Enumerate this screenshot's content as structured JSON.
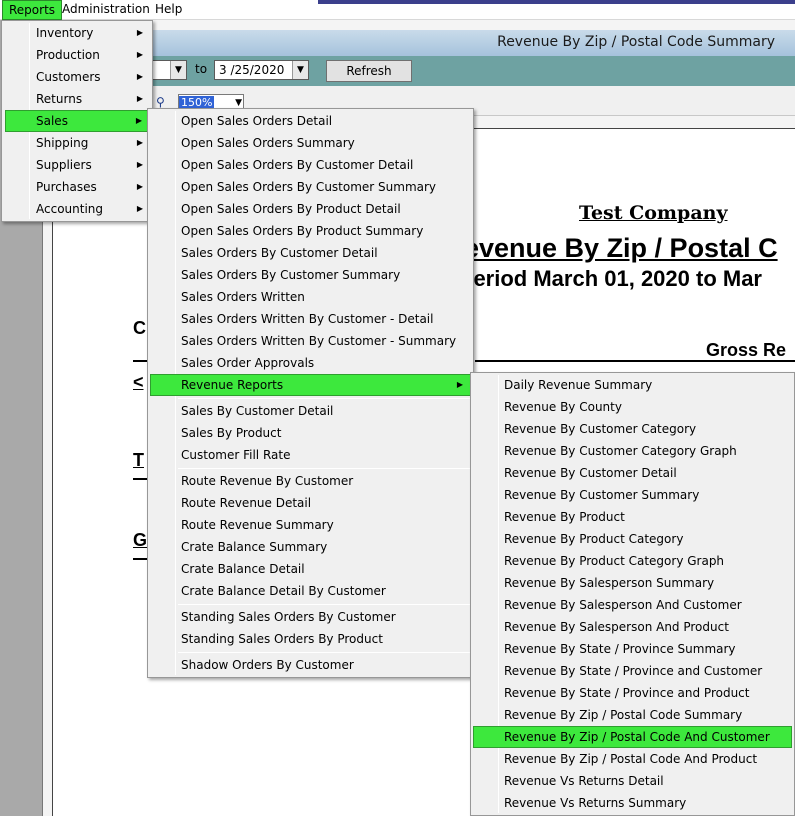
{
  "menubar": {
    "items": [
      "Reports",
      "Administration",
      "Help"
    ]
  },
  "window": {
    "title": "Revenue By Zip / Postal Code Summary"
  },
  "filter": {
    "to_label": "to",
    "end_date": "3 /25/2020",
    "refresh_label": "Refresh",
    "zoom": "150%"
  },
  "report": {
    "company": "Test Company",
    "title": "evenue By Zip / Postal C",
    "period": "period March 01, 2020 to Mar",
    "gross_header": "Gross Re",
    "left_fragments": [
      "C",
      "<",
      "T",
      "G"
    ]
  },
  "reports_menu": {
    "items": [
      {
        "label": "Inventory",
        "submenu": true
      },
      {
        "label": "Production",
        "submenu": true
      },
      {
        "label": "Customers",
        "submenu": true
      },
      {
        "label": "Returns",
        "submenu": true
      },
      {
        "label": "Sales",
        "submenu": true,
        "highlighted": true
      },
      {
        "label": "Shipping",
        "submenu": true
      },
      {
        "label": "Suppliers",
        "submenu": true
      },
      {
        "label": "Purchases",
        "submenu": true
      },
      {
        "label": "Accounting",
        "submenu": true
      }
    ]
  },
  "sales_menu": {
    "items": [
      "Open Sales Orders Detail",
      "Open Sales Orders Summary",
      "Open Sales Orders By Customer Detail",
      "Open Sales Orders By Customer Summary",
      "Open Sales Orders By Product Detail",
      "Open Sales Orders By Product Summary",
      "Sales Orders By Customer Detail",
      "Sales Orders By Customer Summary",
      "Sales Orders Written",
      "Sales Orders Written By Customer - Detail",
      "Sales Orders Written By Customer - Summary",
      "Sales Order Approvals",
      "Revenue Reports",
      "Sales By Customer Detail",
      "Sales By Product",
      "Customer Fill Rate",
      "Route Revenue By Customer",
      "Route Revenue Detail",
      "Route Revenue Summary",
      "Crate Balance Summary",
      "Crate Balance Detail",
      "Crate Balance Detail By Customer",
      "Standing Sales Orders By Customer",
      "Standing Sales Orders By Product",
      "Shadow Orders By Customer"
    ],
    "highlighted": "Revenue Reports"
  },
  "revenue_menu": {
    "items": [
      "Daily Revenue Summary",
      "Revenue By County",
      "Revenue By Customer Category",
      "Revenue By Customer Category Graph",
      "Revenue By Customer Detail",
      "Revenue By Customer Summary",
      "Revenue By Product",
      "Revenue By Product Category",
      "Revenue By Product Category Graph",
      "Revenue By Salesperson Summary",
      "Revenue By Salesperson And Customer",
      "Revenue By Salesperson And Product",
      "Revenue By State / Province Summary",
      "Revenue By State / Province and Customer",
      "Revenue By State / Province and Product",
      "Revenue By Zip / Postal Code Summary",
      "Revenue By Zip / Postal Code And Customer",
      "Revenue By Zip / Postal Code And Product",
      "Revenue Vs Returns Detail",
      "Revenue Vs Returns Summary"
    ],
    "highlighted": "Revenue By Zip / Postal Code And Customer"
  },
  "colors": {
    "highlight": "#3de83d",
    "toolbar": "#6ea2a2",
    "titlebar": "#a5c2dc"
  }
}
